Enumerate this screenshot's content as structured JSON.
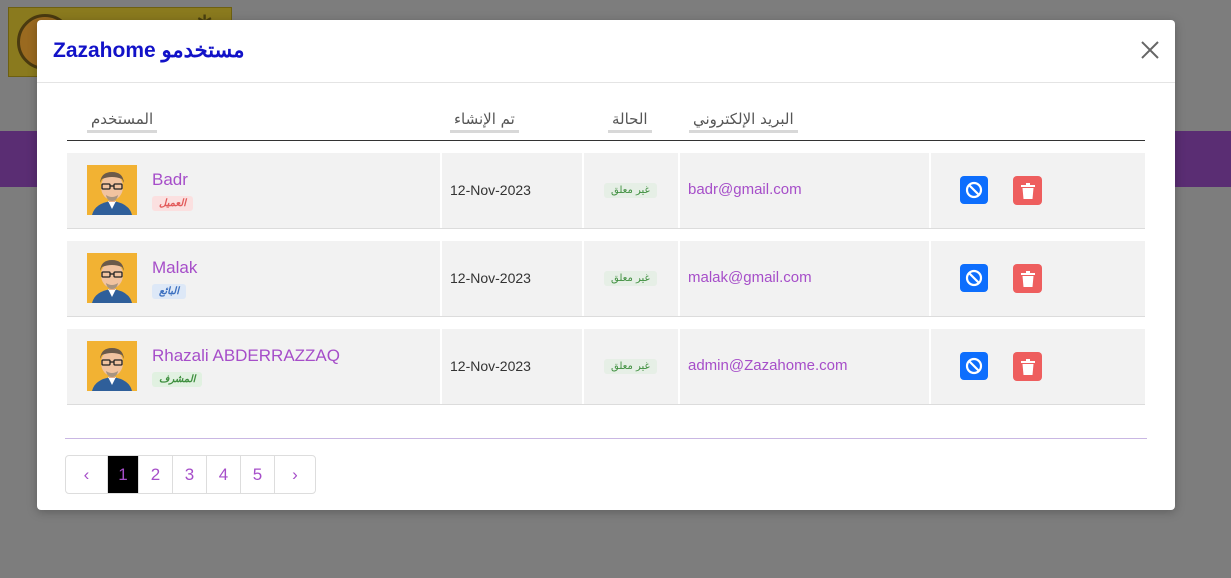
{
  "modal": {
    "title": "Zazahome مستخدمو",
    "close_icon": "close-icon"
  },
  "table": {
    "headers": {
      "user": "المستخدم",
      "created": "تم الإنشاء",
      "status": "الحالة",
      "email": "البريد الإلكتروني"
    },
    "rows": [
      {
        "name": "Badr",
        "role": "العميل",
        "role_color": "#e25a5a",
        "created": "12-Nov-2023",
        "status": "غير معلق",
        "email": "badr@gmail.com"
      },
      {
        "name": "Malak",
        "role": "البائع",
        "role_color": "#3b6fbf",
        "created": "12-Nov-2023",
        "status": "غير معلق",
        "email": "malak@gmail.com"
      },
      {
        "name": "Rhazali ABDERRAZZAQ",
        "role": "المشرف",
        "role_color": "#3f8f3f",
        "created": "12-Nov-2023",
        "status": "غير معلق",
        "email": "admin@Zazahome.com"
      }
    ]
  },
  "pagination": {
    "prev": "‹",
    "pages": [
      "1",
      "2",
      "3",
      "4",
      "5"
    ],
    "active_page": "1",
    "next": "›"
  },
  "colors": {
    "accent": "#a64ec9",
    "title": "#1212c8",
    "block_button": "#0d6efd",
    "delete_button": "#ee5e5e"
  }
}
